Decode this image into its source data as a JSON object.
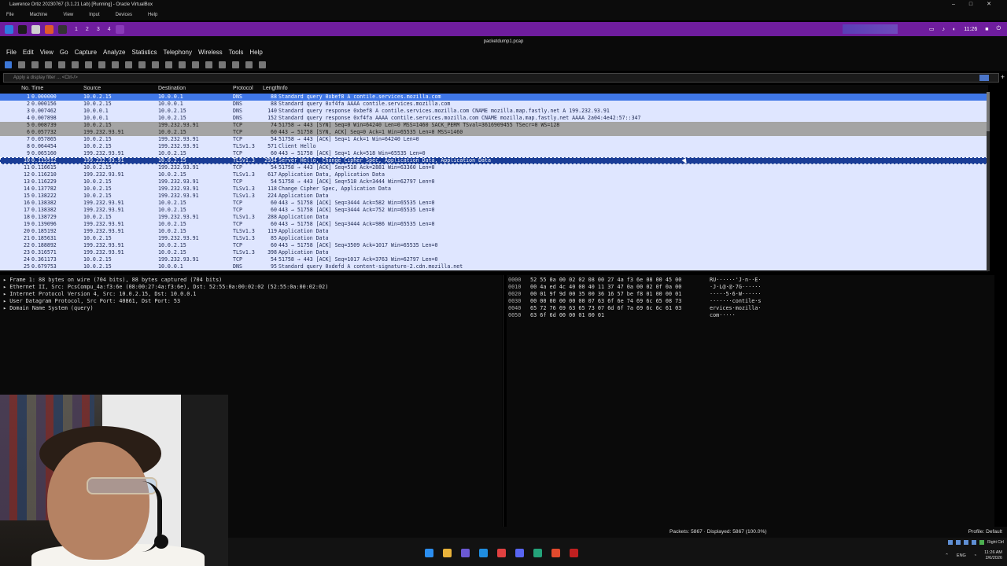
{
  "window": {
    "vm_title": "Lawrence Ortiz 20230767 (3.1.21 Lab) [Running] - Oracle VirtualBox",
    "vb_menu": [
      "File",
      "Machine",
      "View",
      "Input",
      "Devices",
      "Help"
    ],
    "workspaces": [
      "1",
      "2",
      "3",
      "4"
    ],
    "guest_clock": "11:26",
    "ws_title": "packetdump1.pcap"
  },
  "menu": [
    "File",
    "Edit",
    "View",
    "Go",
    "Capture",
    "Analyze",
    "Statistics",
    "Telephony",
    "Wireless",
    "Tools",
    "Help"
  ],
  "filter": {
    "placeholder": "Apply a display filter ... <Ctrl-/>"
  },
  "columns": {
    "no": "No.",
    "time": "Time",
    "source": "Source",
    "destination": "Destination",
    "protocol": "Protocol",
    "length": "Length",
    "info": "Info"
  },
  "packets": [
    {
      "no": "1",
      "time": "0.000000",
      "src": "10.0.2.15",
      "dst": "10.0.0.1",
      "proto": "DNS",
      "len": "88",
      "info": "Standard query 0xbef8 A contile.services.mozilla.com",
      "style": "hl"
    },
    {
      "no": "2",
      "time": "0.000156",
      "src": "10.0.2.15",
      "dst": "10.0.0.1",
      "proto": "DNS",
      "len": "88",
      "info": "Standard query 0xf4fa AAAA contile.services.mozilla.com",
      "style": ""
    },
    {
      "no": "3",
      "time": "0.007462",
      "src": "10.0.0.1",
      "dst": "10.0.2.15",
      "proto": "DNS",
      "len": "140",
      "info": "Standard query response 0xbef8 A contile.services.mozilla.com CNAME mozilla.map.fastly.net A 199.232.93.91",
      "style": ""
    },
    {
      "no": "4",
      "time": "0.007898",
      "src": "10.0.0.1",
      "dst": "10.0.2.15",
      "proto": "DNS",
      "len": "152",
      "info": "Standard query response 0xf4fa AAAA contile.services.mozilla.com CNAME mozilla.map.fastly.net AAAA 2a04:4e42:57::347",
      "style": ""
    },
    {
      "no": "5",
      "time": "0.008739",
      "src": "10.0.2.15",
      "dst": "199.232.93.91",
      "proto": "TCP",
      "len": "74",
      "info": "51758 → 443 [SYN] Seq=0 Win=64240 Len=0 MSS=1460 SACK_PERM TSval=3616909455 TSecr=0 WS=128",
      "style": "gray"
    },
    {
      "no": "6",
      "time": "0.057732",
      "src": "199.232.93.91",
      "dst": "10.0.2.15",
      "proto": "TCP",
      "len": "60",
      "info": "443 → 51758 [SYN, ACK] Seq=0 Ack=1 Win=65535 Len=0 MSS=1460",
      "style": "gray"
    },
    {
      "no": "7",
      "time": "0.057865",
      "src": "10.0.2.15",
      "dst": "199.232.93.91",
      "proto": "TCP",
      "len": "54",
      "info": "51758 → 443 [ACK] Seq=1 Ack=1 Win=64240 Len=0",
      "style": ""
    },
    {
      "no": "8",
      "time": "0.064454",
      "src": "10.0.2.15",
      "dst": "199.232.93.91",
      "proto": "TLSv1.3",
      "len": "571",
      "info": "Client Hello",
      "style": ""
    },
    {
      "no": "9",
      "time": "0.065160",
      "src": "199.232.93.91",
      "dst": "10.0.2.15",
      "proto": "TCP",
      "len": "60",
      "info": "443 → 51758 [ACK] Seq=1 Ack=518 Win=65535 Len=0",
      "style": ""
    },
    {
      "no": "10",
      "time": "0.115512",
      "src": "199.232.93.91",
      "dst": "10.0.2.15",
      "proto": "TLSv1.3",
      "len": "2934",
      "info": "Server Hello, Change Cipher Spec, Application Data, Application Data",
      "style": "sel"
    },
    {
      "no": "11",
      "time": "0.116615",
      "src": "10.0.2.15",
      "dst": "199.232.93.91",
      "proto": "TCP",
      "len": "54",
      "info": "51758 → 443 [ACK] Seq=518 Ack=2881 Win=63360 Len=0",
      "style": ""
    },
    {
      "no": "12",
      "time": "0.116210",
      "src": "199.232.93.91",
      "dst": "10.0.2.15",
      "proto": "TLSv1.3",
      "len": "617",
      "info": "Application Data, Application Data",
      "style": ""
    },
    {
      "no": "13",
      "time": "0.116229",
      "src": "10.0.2.15",
      "dst": "199.232.93.91",
      "proto": "TCP",
      "len": "54",
      "info": "51758 → 443 [ACK] Seq=518 Ack=3444 Win=62797 Len=0",
      "style": ""
    },
    {
      "no": "14",
      "time": "0.137782",
      "src": "10.0.2.15",
      "dst": "199.232.93.91",
      "proto": "TLSv1.3",
      "len": "118",
      "info": "Change Cipher Spec, Application Data",
      "style": ""
    },
    {
      "no": "15",
      "time": "0.138222",
      "src": "10.0.2.15",
      "dst": "199.232.93.91",
      "proto": "TLSv1.3",
      "len": "224",
      "info": "Application Data",
      "style": ""
    },
    {
      "no": "16",
      "time": "0.138382",
      "src": "199.232.93.91",
      "dst": "10.0.2.15",
      "proto": "TCP",
      "len": "60",
      "info": "443 → 51758 [ACK] Seq=3444 Ack=582 Win=65535 Len=0",
      "style": ""
    },
    {
      "no": "17",
      "time": "0.138382",
      "src": "199.232.93.91",
      "dst": "10.0.2.15",
      "proto": "TCP",
      "len": "60",
      "info": "443 → 51758 [ACK] Seq=3444 Ack=752 Win=65535 Len=0",
      "style": ""
    },
    {
      "no": "18",
      "time": "0.138729",
      "src": "10.0.2.15",
      "dst": "199.232.93.91",
      "proto": "TLSv1.3",
      "len": "288",
      "info": "Application Data",
      "style": ""
    },
    {
      "no": "19",
      "time": "0.139096",
      "src": "199.232.93.91",
      "dst": "10.0.2.15",
      "proto": "TCP",
      "len": "60",
      "info": "443 → 51758 [ACK] Seq=3444 Ack=986 Win=65535 Len=0",
      "style": ""
    },
    {
      "no": "20",
      "time": "0.185192",
      "src": "199.232.93.91",
      "dst": "10.0.2.15",
      "proto": "TLSv1.3",
      "len": "119",
      "info": "Application Data",
      "style": ""
    },
    {
      "no": "21",
      "time": "0.185631",
      "src": "10.0.2.15",
      "dst": "199.232.93.91",
      "proto": "TLSv1.3",
      "len": "85",
      "info": "Application Data",
      "style": ""
    },
    {
      "no": "22",
      "time": "0.188892",
      "src": "199.232.93.91",
      "dst": "10.0.2.15",
      "proto": "TCP",
      "len": "60",
      "info": "443 → 51758 [ACK] Seq=3509 Ack=1017 Win=65535 Len=0",
      "style": ""
    },
    {
      "no": "23",
      "time": "0.316571",
      "src": "199.232.93.91",
      "dst": "10.0.2.15",
      "proto": "TLSv1.3",
      "len": "398",
      "info": "Application Data",
      "style": ""
    },
    {
      "no": "24",
      "time": "0.361173",
      "src": "10.0.2.15",
      "dst": "199.232.93.91",
      "proto": "TCP",
      "len": "54",
      "info": "51758 → 443 [ACK] Seq=1017 Ack=3763 Win=62797 Len=0",
      "style": ""
    },
    {
      "no": "25",
      "time": "0.679753",
      "src": "10.0.2.15",
      "dst": "10.0.0.1",
      "proto": "DNS",
      "len": "95",
      "info": "Standard query 0xdefd A content-signature-2.cdn.mozilla.net",
      "style": ""
    }
  ],
  "details": [
    "Frame 1: 88 bytes on wire (704 bits), 88 bytes captured (704 bits)",
    "Ethernet II, Src: PcsCompu_4a:f3:6e (08:00:27:4a:f3:6e), Dst: 52:55:0a:00:02:02 (52:55:0a:00:02:02)",
    "Internet Protocol Version 4, Src: 10.0.2.15, Dst: 10.0.0.1",
    "User Datagram Protocol, Src Port: 40861, Dst Port: 53",
    "Domain Name System (query)"
  ],
  "hex": [
    {
      "off": "0000",
      "bytes": "52 55 0a 00 02 02 08 00  27 4a f3 6e 08 00 45 00",
      "ascii": "RU······'J·n··E·"
    },
    {
      "off": "0010",
      "bytes": "00 4a ed 4c 40 00 40 11  37 47 0a 00 02 0f 0a 00",
      "ascii": "·J·L@·@·7G······"
    },
    {
      "off": "0020",
      "bytes": "00 01 9f 9d 00 35 00 36  16 57 be f8 01 00 00 01",
      "ascii": "·····5·6·W······"
    },
    {
      "off": "0030",
      "bytes": "00 00 00 00 00 00 07 63  6f 6e 74 69 6c 65 08 73",
      "ascii": "·······contile·s"
    },
    {
      "off": "0040",
      "bytes": "65 72 76 69 63 65 73 07  6d 6f 7a 69 6c 6c 61 03",
      "ascii": "ervices·mozilla·"
    },
    {
      "off": "0050",
      "bytes": "63 6f 6d 00 00 01 00 01",
      "ascii": "com·····"
    }
  ],
  "status": {
    "packets": "Packets: 5867 · Displayed: 5867 (100.0%)",
    "profile": "Profile: Default"
  },
  "taskbar": {
    "lang": "ENG",
    "time": "11:26 AM",
    "date": "2/6/2026",
    "tray_label": "Right Ctrl"
  }
}
